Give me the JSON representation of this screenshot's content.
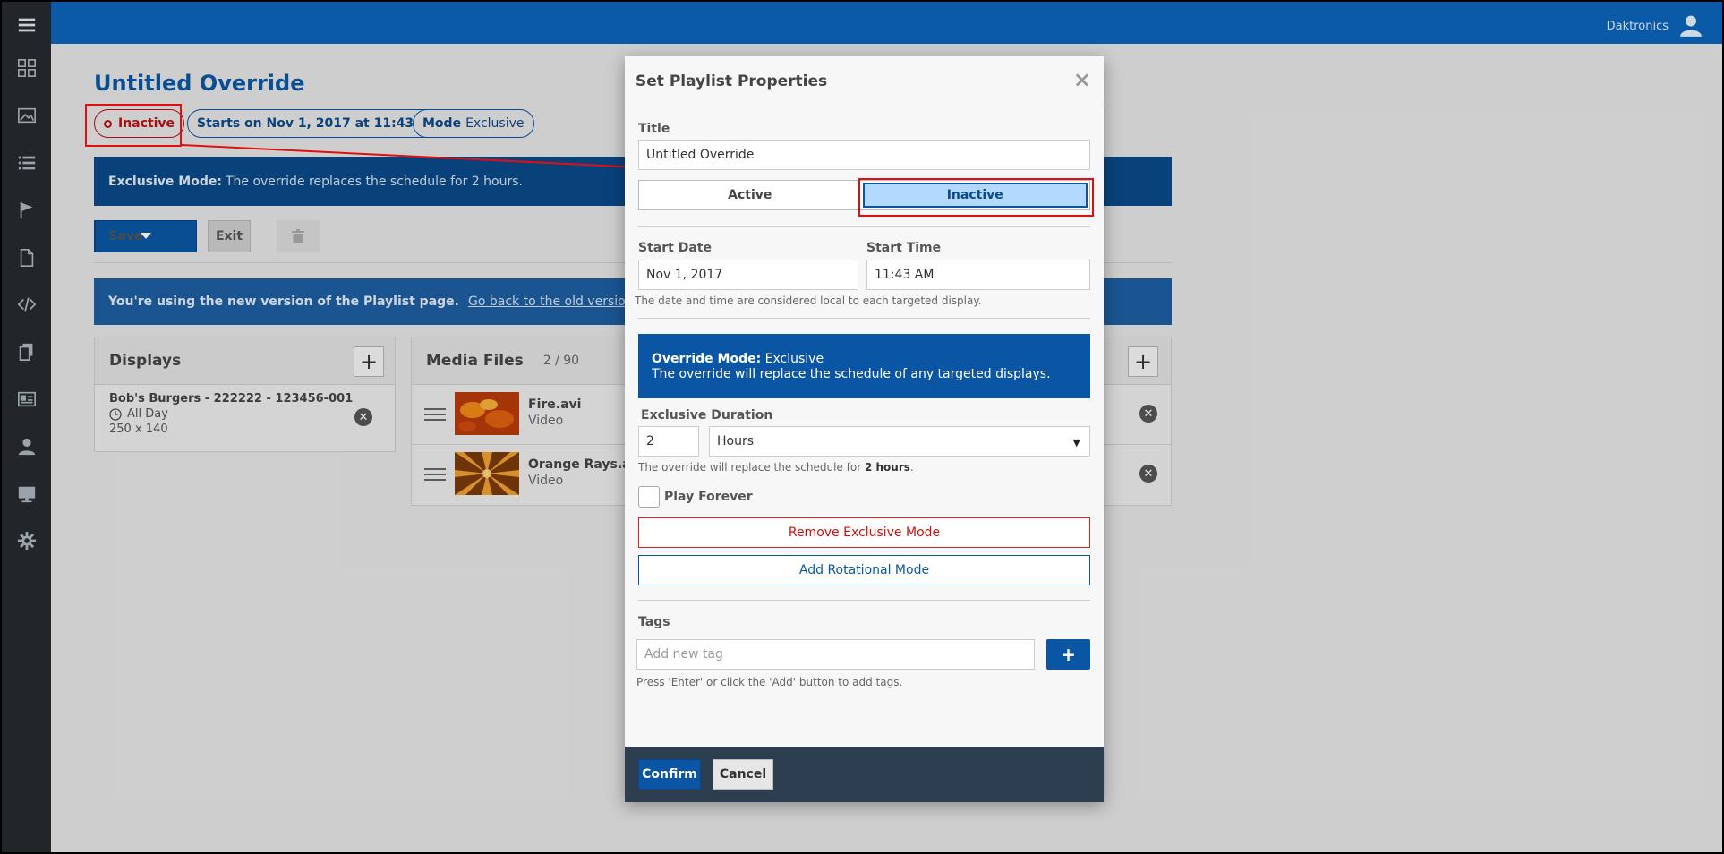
{
  "topbar": {
    "user_name": "Daktronics"
  },
  "sidebar": {
    "items": [
      {
        "icon": "menu-icon"
      },
      {
        "icon": "dashboard-icon"
      },
      {
        "icon": "image-icon"
      },
      {
        "icon": "list-icon"
      },
      {
        "icon": "flag-icon"
      },
      {
        "icon": "document-icon"
      },
      {
        "icon": "code-icon"
      },
      {
        "icon": "copy-icon"
      },
      {
        "icon": "id-card-icon"
      },
      {
        "icon": "user-icon"
      },
      {
        "icon": "monitor-icon"
      },
      {
        "icon": "gear-icon"
      }
    ]
  },
  "page": {
    "title": "Untitled Override",
    "status_pill": "Inactive",
    "starts_pill": "Starts on Nov 1, 2017 at 11:43 AM",
    "mode_pill_label": "Mode",
    "mode_pill_value": "Exclusive",
    "exclusive_banner_bold": "Exclusive Mode:",
    "exclusive_banner_text": "The override replaces the schedule for 2 hours.",
    "save_label": "Save",
    "exit_label": "Exit",
    "version_banner_bold": "You're using the new version of the Playlist page.",
    "version_banner_link": "Go back to the old version."
  },
  "displays_panel": {
    "title": "Displays",
    "items": [
      {
        "name": "Bob's Burgers - 222222 - 123456-001",
        "schedule": "All Day",
        "size": "250 x 140"
      }
    ]
  },
  "media_panel": {
    "title": "Media Files",
    "count": "2 / 90",
    "items": [
      {
        "name": "Fire.avi",
        "type": "Video"
      },
      {
        "name": "Orange Rays.avi",
        "type": "Video"
      }
    ]
  },
  "modal": {
    "title": "Set Playlist Properties",
    "title_label": "Title",
    "title_value": "Untitled Override",
    "active_option": "Active",
    "inactive_option": "Inactive",
    "start_date_label": "Start Date",
    "start_date_value": "Nov 1, 2017",
    "start_time_label": "Start Time",
    "start_time_value": "11:43 AM",
    "local_time_hint": "The date and time are considered local to each targeted display.",
    "mode_box_bold": "Override Mode:",
    "mode_box_value": "Exclusive",
    "mode_box_desc": "The override will replace the schedule of any targeted displays.",
    "duration_label": "Exclusive Duration",
    "duration_value": "2",
    "duration_unit": "Hours",
    "duration_hint_prefix": "The override will replace the schedule for",
    "duration_hint_bold": "2 hours",
    "duration_hint_suffix": ".",
    "play_forever_label": "Play Forever",
    "remove_exclusive_label": "Remove Exclusive Mode",
    "add_rotational_label": "Add Rotational Mode",
    "tags_label": "Tags",
    "tag_placeholder": "Add new tag",
    "add_tag_symbol": "+",
    "tags_hint": "Press 'Enter' or click the 'Add' button to add tags.",
    "confirm_label": "Confirm",
    "cancel_label": "Cancel"
  },
  "colors": {
    "brand_blue": "#0b56a4",
    "annotation_red": "#e01010",
    "inactive_red": "#bb1111",
    "selected_option": "#b3d9ff"
  }
}
